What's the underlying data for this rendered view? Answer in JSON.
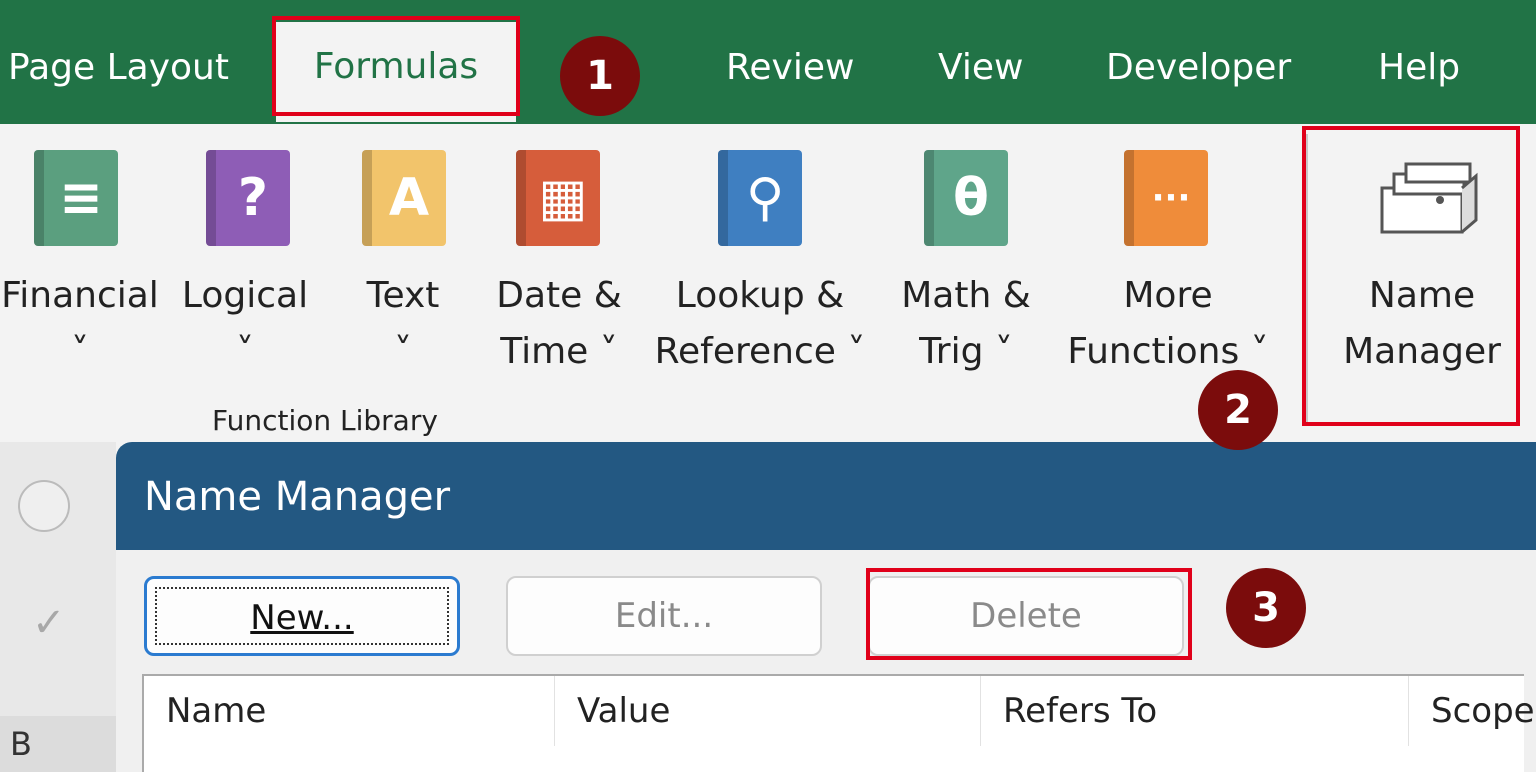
{
  "tabs": {
    "page_layout": "Page Layout",
    "formulas": "Formulas",
    "review": "Review",
    "view": "View",
    "developer": "Developer",
    "help": "Help"
  },
  "ribbon": {
    "buttons": [
      {
        "line1": "Financial",
        "line2": "˅",
        "icon": "coins-book-icon",
        "color": "#5b9f7f",
        "glyph": "≡"
      },
      {
        "line1": "Logical",
        "line2": "˅",
        "icon": "question-book-icon",
        "color": "#8e5db6",
        "glyph": "?"
      },
      {
        "line1": "Text",
        "line2": "˅",
        "icon": "text-book-icon",
        "color": "#f2c46b",
        "glyph": "A"
      },
      {
        "line1": "Date &",
        "line2": "Time ˅",
        "icon": "calendar-book-icon",
        "color": "#d65d3b",
        "glyph": "▦"
      },
      {
        "line1": "Lookup &",
        "line2": "Reference ˅",
        "icon": "magnifier-book-icon",
        "color": "#3f7fc1",
        "glyph": "⚲"
      },
      {
        "line1": "Math &",
        "line2": "Trig ˅",
        "icon": "theta-book-icon",
        "color": "#5fa58a",
        "glyph": "θ"
      },
      {
        "line1": "More",
        "line2": "Functions ˅",
        "icon": "more-book-icon",
        "color": "#ef8c3a",
        "glyph": "···"
      }
    ],
    "group_label": "Function Library",
    "name_manager": {
      "line1": "Name",
      "line2": "Manager",
      "icon": "name-manager-icon"
    }
  },
  "badges": {
    "b1": "1",
    "b2": "2",
    "b3": "3"
  },
  "sheet": {
    "column_b": "B",
    "check_glyph": "✓"
  },
  "dialog": {
    "title": "Name Manager",
    "new_label": "New...",
    "edit_label": "Edit...",
    "delete_label": "Delete",
    "columns": [
      "Name",
      "Value",
      "Refers To",
      "Scope"
    ]
  },
  "colors": {
    "excel_green": "#217346",
    "dialog_blue": "#235882",
    "highlight": "#e0001a",
    "badge": "#7b0c0c"
  }
}
